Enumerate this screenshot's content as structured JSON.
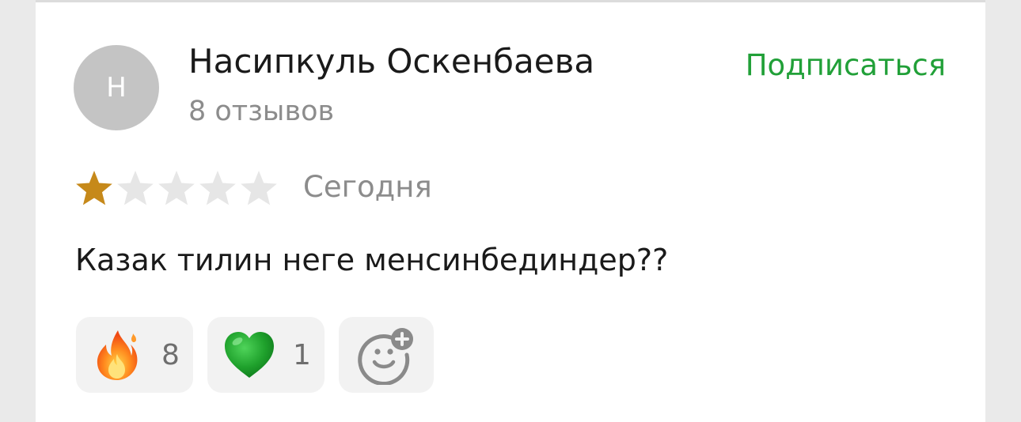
{
  "author": {
    "avatar_letter": "Н",
    "name": "Насипкуль Оскенбаева",
    "reviews": "8 отзывов"
  },
  "subscribe_label": "Подписаться",
  "rating": {
    "value": 1,
    "max": 5,
    "filled_color": "#c6891a",
    "empty_color": "#e6e6e6"
  },
  "date": "Сегодня",
  "review_text": "Казак тилин неге менсинбединдер??",
  "reactions": [
    {
      "icon": "fire-emoji-icon",
      "count": "8"
    },
    {
      "icon": "green-heart-emoji-icon",
      "count": "1"
    },
    {
      "icon": "add-reaction-icon"
    }
  ],
  "colors": {
    "accent": "#21a038",
    "muted_text": "#8c8c8c",
    "reaction_bg": "#f2f2f2"
  }
}
